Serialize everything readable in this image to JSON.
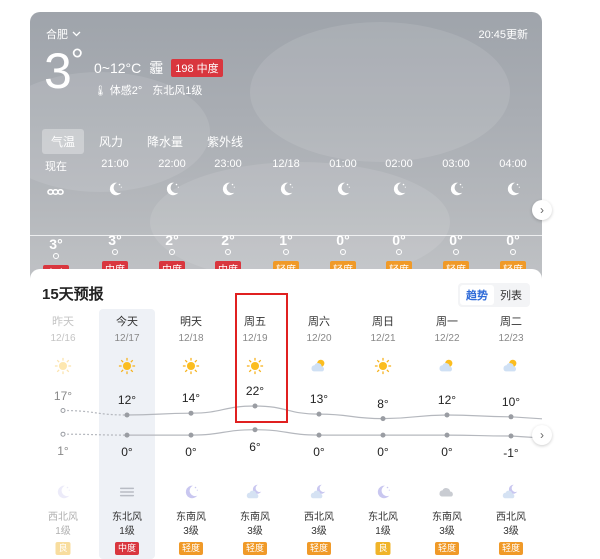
{
  "location": {
    "name": "合肥",
    "update_time": "20:45更新"
  },
  "current": {
    "temp": "3",
    "degree": "°",
    "range": "0~12°C",
    "condition": "霾",
    "aqi": "198 中度",
    "feels_like": "体感2°",
    "wind": "东北风1级"
  },
  "colors": {
    "aqi_moderate": "#d9363e",
    "aqi_light": "#f09a28",
    "aqi_good": "#f0b429",
    "accent": "#2f6bd8"
  },
  "tabs": [
    "气温",
    "风力",
    "降水量",
    "紫外线"
  ],
  "hourly": [
    {
      "time": "现在",
      "icon": "haze-icon",
      "temp": "3°",
      "aqi": "中度",
      "level": "moderate"
    },
    {
      "time": "21:00",
      "icon": "moon-icon",
      "temp": "3°",
      "aqi": "中度",
      "level": "moderate"
    },
    {
      "time": "22:00",
      "icon": "moon-icon",
      "temp": "2°",
      "aqi": "中度",
      "level": "moderate"
    },
    {
      "time": "23:00",
      "icon": "moon-icon",
      "temp": "2°",
      "aqi": "中度",
      "level": "moderate"
    },
    {
      "time": "12/18",
      "icon": "moon-icon",
      "temp": "1°",
      "aqi": "轻度",
      "level": "light"
    },
    {
      "time": "01:00",
      "icon": "moon-icon",
      "temp": "0°",
      "aqi": "轻度",
      "level": "light"
    },
    {
      "time": "02:00",
      "icon": "moon-icon",
      "temp": "0°",
      "aqi": "轻度",
      "level": "light"
    },
    {
      "time": "03:00",
      "icon": "moon-icon",
      "temp": "0°",
      "aqi": "轻度",
      "level": "light"
    },
    {
      "time": "04:00",
      "icon": "moon-icon",
      "temp": "0°",
      "aqi": "轻度",
      "level": "light"
    }
  ],
  "forecast": {
    "title": "15天预报",
    "toggle": {
      "trend": "趋势",
      "list": "列表"
    },
    "days": [
      {
        "name": "昨天",
        "date": "12/16",
        "day_icon": "sun-icon",
        "high": "17°",
        "low": "1°",
        "night_icon": "moon-icon",
        "wind_dir": "西北风",
        "wind_lvl": "1级",
        "aqi": "良",
        "level": "good",
        "past": true
      },
      {
        "name": "今天",
        "date": "12/17",
        "day_icon": "sun-icon",
        "high": "12°",
        "low": "0°",
        "night_icon": "haze-icon",
        "wind_dir": "东北风",
        "wind_lvl": "1级",
        "aqi": "中度",
        "level": "moderate",
        "today": true
      },
      {
        "name": "明天",
        "date": "12/18",
        "day_icon": "sun-icon",
        "high": "14°",
        "low": "0°",
        "night_icon": "moon-icon",
        "wind_dir": "东南风",
        "wind_lvl": "3级",
        "aqi": "轻度",
        "level": "light"
      },
      {
        "name": "周五",
        "date": "12/19",
        "day_icon": "sun-icon",
        "high": "22°",
        "low": "6°",
        "night_icon": "moon-cloud-icon",
        "wind_dir": "东南风",
        "wind_lvl": "3级",
        "aqi": "轻度",
        "level": "light"
      },
      {
        "name": "周六",
        "date": "12/20",
        "day_icon": "sun-cloud-icon",
        "high": "13°",
        "low": "0°",
        "night_icon": "moon-cloud-icon",
        "wind_dir": "西北风",
        "wind_lvl": "3级",
        "aqi": "轻度",
        "level": "light"
      },
      {
        "name": "周日",
        "date": "12/21",
        "day_icon": "sun-icon",
        "high": "8°",
        "low": "0°",
        "night_icon": "moon-icon",
        "wind_dir": "东北风",
        "wind_lvl": "1级",
        "aqi": "良",
        "level": "good"
      },
      {
        "name": "周一",
        "date": "12/22",
        "day_icon": "sun-cloud-icon",
        "high": "12°",
        "low": "0°",
        "night_icon": "cloud-icon",
        "wind_dir": "东南风",
        "wind_lvl": "3级",
        "aqi": "轻度",
        "level": "light"
      },
      {
        "name": "周二",
        "date": "12/23",
        "day_icon": "sun-cloud-icon",
        "high": "10°",
        "low": "-1°",
        "night_icon": "moon-cloud-icon",
        "wind_dir": "西北风",
        "wind_lvl": "3级",
        "aqi": "轻度",
        "level": "light"
      }
    ]
  }
}
